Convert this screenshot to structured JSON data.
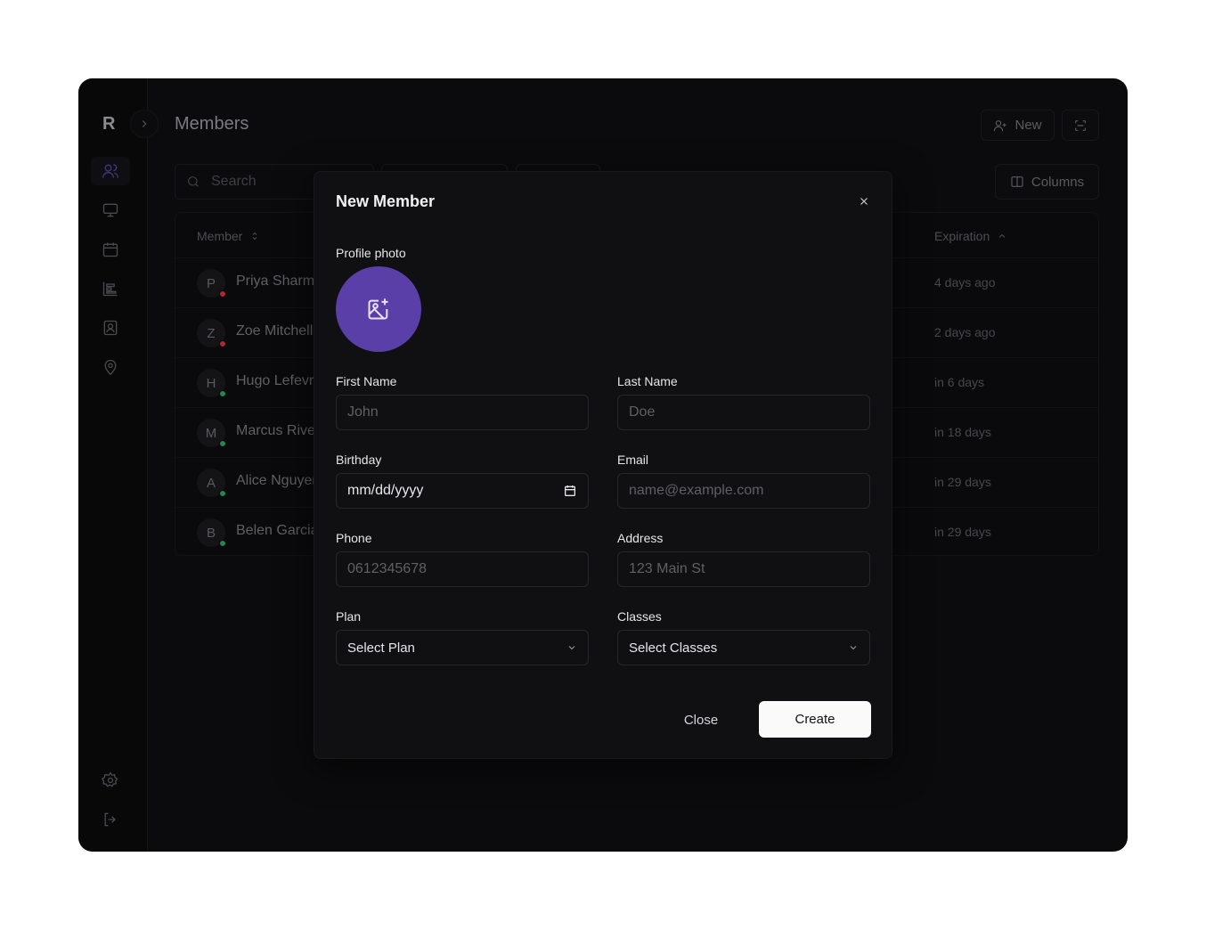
{
  "app": {
    "logo": "R",
    "page_title": "Members",
    "new_label": "New",
    "columns_label": "Columns",
    "search_placeholder": "Search"
  },
  "sidebar": {
    "items": [
      {
        "icon": "users-icon",
        "active": true
      },
      {
        "icon": "monitor-icon",
        "active": false
      },
      {
        "icon": "calendar-icon",
        "active": false
      },
      {
        "icon": "chart-icon",
        "active": false
      },
      {
        "icon": "contact-icon",
        "active": false
      },
      {
        "icon": "map-pin-icon",
        "active": false
      }
    ],
    "bottom": [
      {
        "icon": "gear-icon"
      },
      {
        "icon": "logout-icon"
      }
    ]
  },
  "table": {
    "headers": {
      "member": "Member",
      "expiration": "Expiration"
    },
    "rows": [
      {
        "initial": "P",
        "name": "Priya Sharma",
        "status_color": "#b3262e",
        "expiration": "4 days ago"
      },
      {
        "initial": "Z",
        "name": "Zoe Mitchell",
        "status_color": "#b3262e",
        "expiration": "2 days ago"
      },
      {
        "initial": "H",
        "name": "Hugo Lefevre",
        "status_color": "#1f8a4c",
        "expiration": "in 6 days"
      },
      {
        "initial": "M",
        "name": "Marcus Rivera",
        "status_color": "#1f8a4c",
        "expiration": "in 18 days"
      },
      {
        "initial": "A",
        "name": "Alice Nguyen",
        "status_color": "#1f8a4c",
        "expiration": "in 29 days"
      },
      {
        "initial": "B",
        "name": "Belen Garcia",
        "status_color": "#1f8a4c",
        "expiration": "in 29 days"
      }
    ]
  },
  "modal": {
    "title": "New Member",
    "profile_photo_label": "Profile photo",
    "accent_color": "#5a3fa8",
    "fields": {
      "first_name": {
        "label": "First Name",
        "placeholder": "John"
      },
      "last_name": {
        "label": "Last Name",
        "placeholder": "Doe"
      },
      "birthday": {
        "label": "Birthday",
        "value": "mm/dd/yyyy"
      },
      "email": {
        "label": "Email",
        "placeholder": "name@example.com"
      },
      "phone": {
        "label": "Phone",
        "placeholder": "0612345678"
      },
      "address": {
        "label": "Address",
        "placeholder": "123 Main St"
      },
      "plan": {
        "label": "Plan",
        "value": "Select Plan"
      },
      "classes": {
        "label": "Classes",
        "value": "Select Classes"
      }
    },
    "close_label": "Close",
    "create_label": "Create"
  }
}
